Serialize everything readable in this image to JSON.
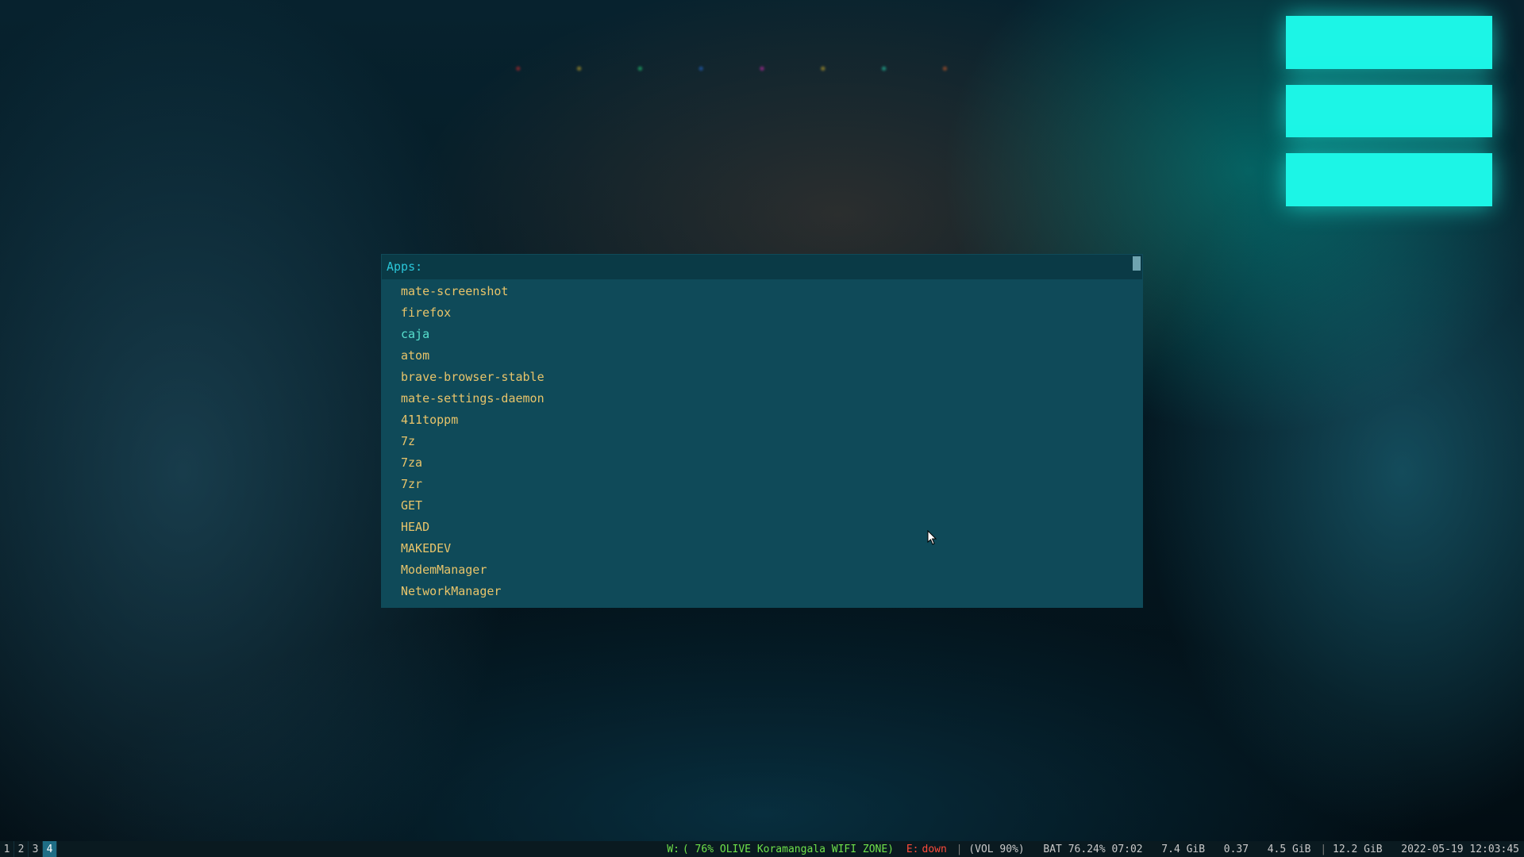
{
  "launcher": {
    "prompt": "Apps:",
    "input_value": "",
    "highlighted_index": 2,
    "items": [
      "mate-screenshot",
      "firefox",
      "caja",
      "atom",
      "brave-browser-stable",
      "mate-settings-daemon",
      "411toppm",
      "7z",
      "7za",
      "7zr",
      "GET",
      "HEAD",
      "MAKEDEV",
      "ModemManager",
      "NetworkManager"
    ]
  },
  "workspaces": {
    "list": [
      "1",
      "2",
      "3",
      "4"
    ],
    "active": "4"
  },
  "status": {
    "wifi_label": "W:",
    "wifi_value": "( 76% OLIVE Koramangala WIFI ZONE)",
    "eth_label": "E:",
    "eth_value": "down",
    "volume": "(VOL 90%)",
    "battery": "BAT 76.24% 07:02",
    "mem_used": "7.4 GiB",
    "load": "0.37",
    "disk_used": "4.5 GiB",
    "disk_total": "12.2 GiB",
    "datetime": "2022-05-19 12:03:45"
  },
  "colors": {
    "launcher_bg": "#0f4a59",
    "launcher_prompt_bg": "#0a3a46",
    "text_normal": "#e8c46a",
    "text_highlight": "#58e0ce",
    "accent_cyan": "#2ac6d8",
    "statusbar_bg": "#0a1a20",
    "status_green": "#6fe24a",
    "status_red": "#ff4a3a"
  }
}
